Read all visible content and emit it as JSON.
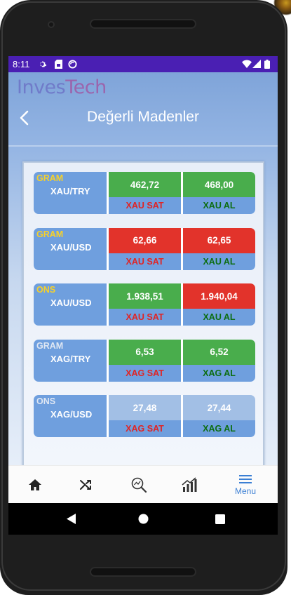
{
  "status_bar": {
    "time": "8:11",
    "icons": [
      "gear-icon",
      "sim-card-icon",
      "sync-icon",
      "wifi-icon",
      "signal-icon",
      "battery-icon"
    ]
  },
  "app": {
    "brand_part1": "Inves",
    "brand_part2": "Tech",
    "title": "Değerli Madenler"
  },
  "rows": [
    {
      "tag": "GRAM",
      "tag_color": "#f6d12a",
      "symbol": "XAU/TRY",
      "left_value": "462,72",
      "left_state": "up",
      "left_action": "XAU SAT",
      "right_value": "468,00",
      "right_state": "up",
      "right_action": "XAU AL"
    },
    {
      "tag": "GRAM",
      "tag_color": "#f6d12a",
      "symbol": "XAU/USD",
      "left_value": "62,66",
      "left_state": "down",
      "left_action": "XAU SAT",
      "right_value": "62,65",
      "right_state": "down",
      "right_action": "XAU AL"
    },
    {
      "tag": "ONS",
      "tag_color": "#f6d12a",
      "symbol": "XAU/USD",
      "left_value": "1.938,51",
      "left_state": "up",
      "left_action": "XAU SAT",
      "right_value": "1.940,04",
      "right_state": "down",
      "right_action": "XAU AL"
    },
    {
      "tag": "GRAM",
      "tag_color": "#dfe7f3",
      "symbol": "XAG/TRY",
      "left_value": "6,53",
      "left_state": "up",
      "left_action": "XAG SAT",
      "right_value": "6,52",
      "right_state": "up",
      "right_action": "XAG AL"
    },
    {
      "tag": "ONS",
      "tag_color": "#dfe7f3",
      "symbol": "XAG/USD",
      "left_value": "27,48",
      "left_state": "neutral",
      "left_action": "XAG SAT",
      "right_value": "27,44",
      "right_state": "neutral",
      "right_action": "XAG AL"
    }
  ],
  "colors": {
    "up": "#49ad4c",
    "down": "#e2332b",
    "neutral": "#a2bfe5",
    "sell_text": "#e02424",
    "buy_text": "#0d6d12",
    "accent": "#3b7fd4",
    "status_bar": "#4a1fb3"
  },
  "bottom_nav": {
    "items": [
      {
        "icon": "home-icon"
      },
      {
        "icon": "shuffle-icon"
      },
      {
        "icon": "search-chart-icon"
      },
      {
        "icon": "bar-chart-icon"
      },
      {
        "icon": "menu-icon",
        "label": "Menu",
        "active": true
      }
    ]
  },
  "system_nav": [
    "back-triangle-icon",
    "home-circle-icon",
    "recents-square-icon"
  ]
}
